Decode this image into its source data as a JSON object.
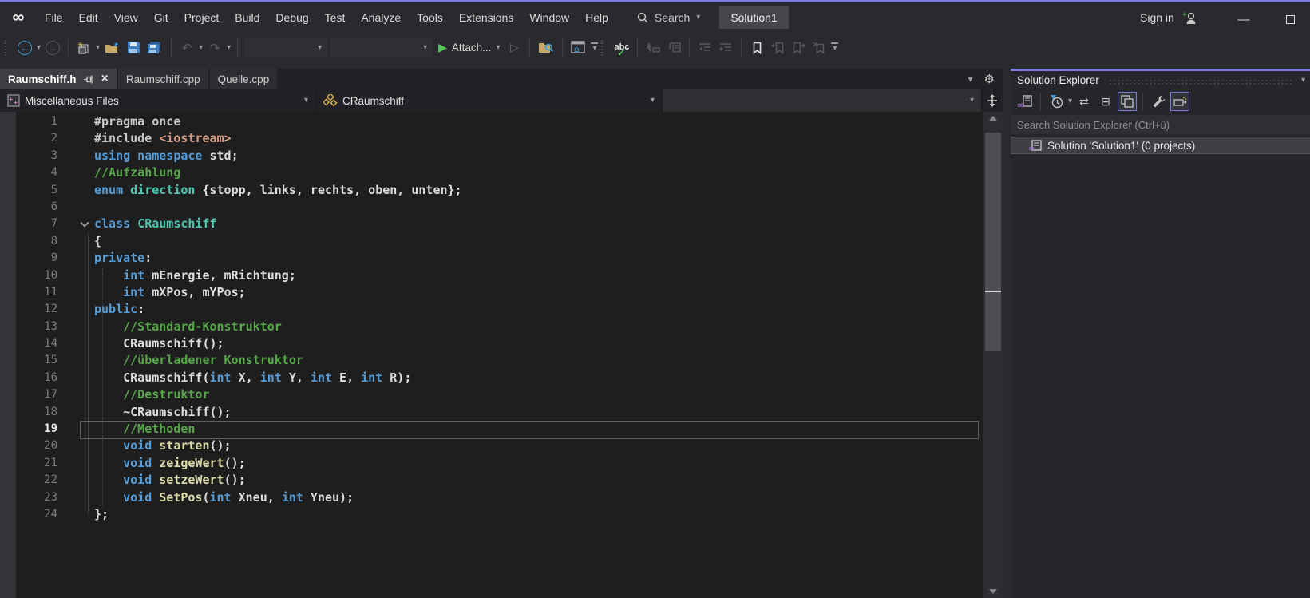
{
  "colors": {
    "accent": "#7b7cd8",
    "keyword": "#569cd6",
    "type": "#4ec9b0",
    "comment": "#57a64a",
    "string": "#d69d85",
    "function": "#dcdcaa"
  },
  "titlebar": {
    "menu": [
      "File",
      "Edit",
      "View",
      "Git",
      "Project",
      "Build",
      "Debug",
      "Test",
      "Analyze",
      "Tools",
      "Extensions",
      "Window",
      "Help"
    ],
    "search_label": "Search",
    "solution_badge": "Solution1",
    "sign_in_label": "Sign in"
  },
  "toolbar": {
    "attach_label": "Attach...",
    "abc_label": "abc"
  },
  "tabs": [
    {
      "label": "Raumschiff.h",
      "active": true,
      "pinned": true
    },
    {
      "label": "Raumschiff.cpp",
      "active": false,
      "pinned": false
    },
    {
      "label": "Quelle.cpp",
      "active": false,
      "pinned": false
    }
  ],
  "navbar": {
    "project_scope": "Miscellaneous Files",
    "type_scope": "CRaumschiff",
    "member_scope": ""
  },
  "editor": {
    "current_line": 19,
    "lines": [
      {
        "n": 1,
        "s": [
          {
            "c": "d",
            "t": "#pragma once"
          }
        ]
      },
      {
        "n": 2,
        "s": [
          {
            "c": "d",
            "t": "#include "
          },
          {
            "c": "s",
            "t": "<iostream>"
          }
        ]
      },
      {
        "n": 3,
        "s": [
          {
            "c": "k",
            "t": "using namespace "
          },
          {
            "c": "p",
            "t": "std;"
          }
        ]
      },
      {
        "n": 4,
        "s": [
          {
            "c": "c",
            "t": "//Aufzählung"
          }
        ]
      },
      {
        "n": 5,
        "s": [
          {
            "c": "k",
            "t": "enum "
          },
          {
            "c": "t",
            "t": "direction "
          },
          {
            "c": "p",
            "t": "{stopp, links, rechts, oben, unten};"
          }
        ]
      },
      {
        "n": 6,
        "s": []
      },
      {
        "n": 7,
        "chevron": true,
        "s": [
          {
            "c": "k",
            "t": "class "
          },
          {
            "c": "t",
            "t": "CRaumschiff"
          }
        ]
      },
      {
        "n": 8,
        "s": [
          {
            "c": "p",
            "t": "{"
          }
        ]
      },
      {
        "n": 9,
        "s": [
          {
            "c": "k",
            "t": "private"
          },
          {
            "c": "p",
            "t": ":"
          }
        ]
      },
      {
        "n": 10,
        "s": [
          {
            "c": "p",
            "t": "    "
          },
          {
            "c": "k",
            "t": "int "
          },
          {
            "c": "p",
            "t": "mEnergie, mRichtung;"
          }
        ]
      },
      {
        "n": 11,
        "s": [
          {
            "c": "p",
            "t": "    "
          },
          {
            "c": "k",
            "t": "int "
          },
          {
            "c": "p",
            "t": "mXPos, mYPos;"
          }
        ]
      },
      {
        "n": 12,
        "s": [
          {
            "c": "k",
            "t": "public"
          },
          {
            "c": "p",
            "t": ":"
          }
        ]
      },
      {
        "n": 13,
        "s": [
          {
            "c": "p",
            "t": "    "
          },
          {
            "c": "c",
            "t": "//Standard-Konstruktor"
          }
        ]
      },
      {
        "n": 14,
        "s": [
          {
            "c": "p",
            "t": "    CRaumschiff();"
          }
        ]
      },
      {
        "n": 15,
        "s": [
          {
            "c": "p",
            "t": "    "
          },
          {
            "c": "c",
            "t": "//überladener Konstruktor"
          }
        ]
      },
      {
        "n": 16,
        "s": [
          {
            "c": "p",
            "t": "    CRaumschiff("
          },
          {
            "c": "k",
            "t": "int"
          },
          {
            "c": "p",
            "t": " X, "
          },
          {
            "c": "k",
            "t": "int"
          },
          {
            "c": "p",
            "t": " Y, "
          },
          {
            "c": "k",
            "t": "int"
          },
          {
            "c": "p",
            "t": " E, "
          },
          {
            "c": "k",
            "t": "int"
          },
          {
            "c": "p",
            "t": " R);"
          }
        ]
      },
      {
        "n": 17,
        "s": [
          {
            "c": "p",
            "t": "    "
          },
          {
            "c": "c",
            "t": "//Destruktor"
          }
        ]
      },
      {
        "n": 18,
        "s": [
          {
            "c": "p",
            "t": "    ~CRaumschiff();"
          }
        ]
      },
      {
        "n": 19,
        "s": [
          {
            "c": "p",
            "t": "    "
          },
          {
            "c": "c",
            "t": "//Methoden"
          }
        ]
      },
      {
        "n": 20,
        "s": [
          {
            "c": "p",
            "t": "    "
          },
          {
            "c": "k",
            "t": "void "
          },
          {
            "c": "f",
            "t": "starten"
          },
          {
            "c": "p",
            "t": "();"
          }
        ]
      },
      {
        "n": 21,
        "s": [
          {
            "c": "p",
            "t": "    "
          },
          {
            "c": "k",
            "t": "void "
          },
          {
            "c": "f",
            "t": "zeigeWert"
          },
          {
            "c": "p",
            "t": "();"
          }
        ]
      },
      {
        "n": 22,
        "s": [
          {
            "c": "p",
            "t": "    "
          },
          {
            "c": "k",
            "t": "void "
          },
          {
            "c": "f",
            "t": "setzeWert"
          },
          {
            "c": "p",
            "t": "();"
          }
        ]
      },
      {
        "n": 23,
        "s": [
          {
            "c": "p",
            "t": "    "
          },
          {
            "c": "k",
            "t": "void "
          },
          {
            "c": "f",
            "t": "SetPos"
          },
          {
            "c": "p",
            "t": "("
          },
          {
            "c": "k",
            "t": "int"
          },
          {
            "c": "p",
            "t": " Xneu, "
          },
          {
            "c": "k",
            "t": "int"
          },
          {
            "c": "p",
            "t": " Yneu);"
          }
        ]
      },
      {
        "n": 24,
        "s": [
          {
            "c": "p",
            "t": "};"
          }
        ]
      }
    ]
  },
  "solution_explorer": {
    "title": "Solution Explorer",
    "search_placeholder": "Search Solution Explorer (Ctrl+ü)",
    "items": [
      {
        "label": "Solution 'Solution1' (0 projects)",
        "selected": true
      }
    ]
  },
  "icons": {
    "caret_down": "▾",
    "close": "×",
    "gear": "⚙",
    "play": "▶",
    "play_outline": "▷",
    "back_arrow": "←",
    "forward_arrow": "→",
    "undo": "↶",
    "redo": "↷",
    "house": "⌂",
    "check": "✓",
    "infinity": "∞",
    "minimize": "—",
    "sync": "⇄",
    "collapse_all": "⊟"
  }
}
